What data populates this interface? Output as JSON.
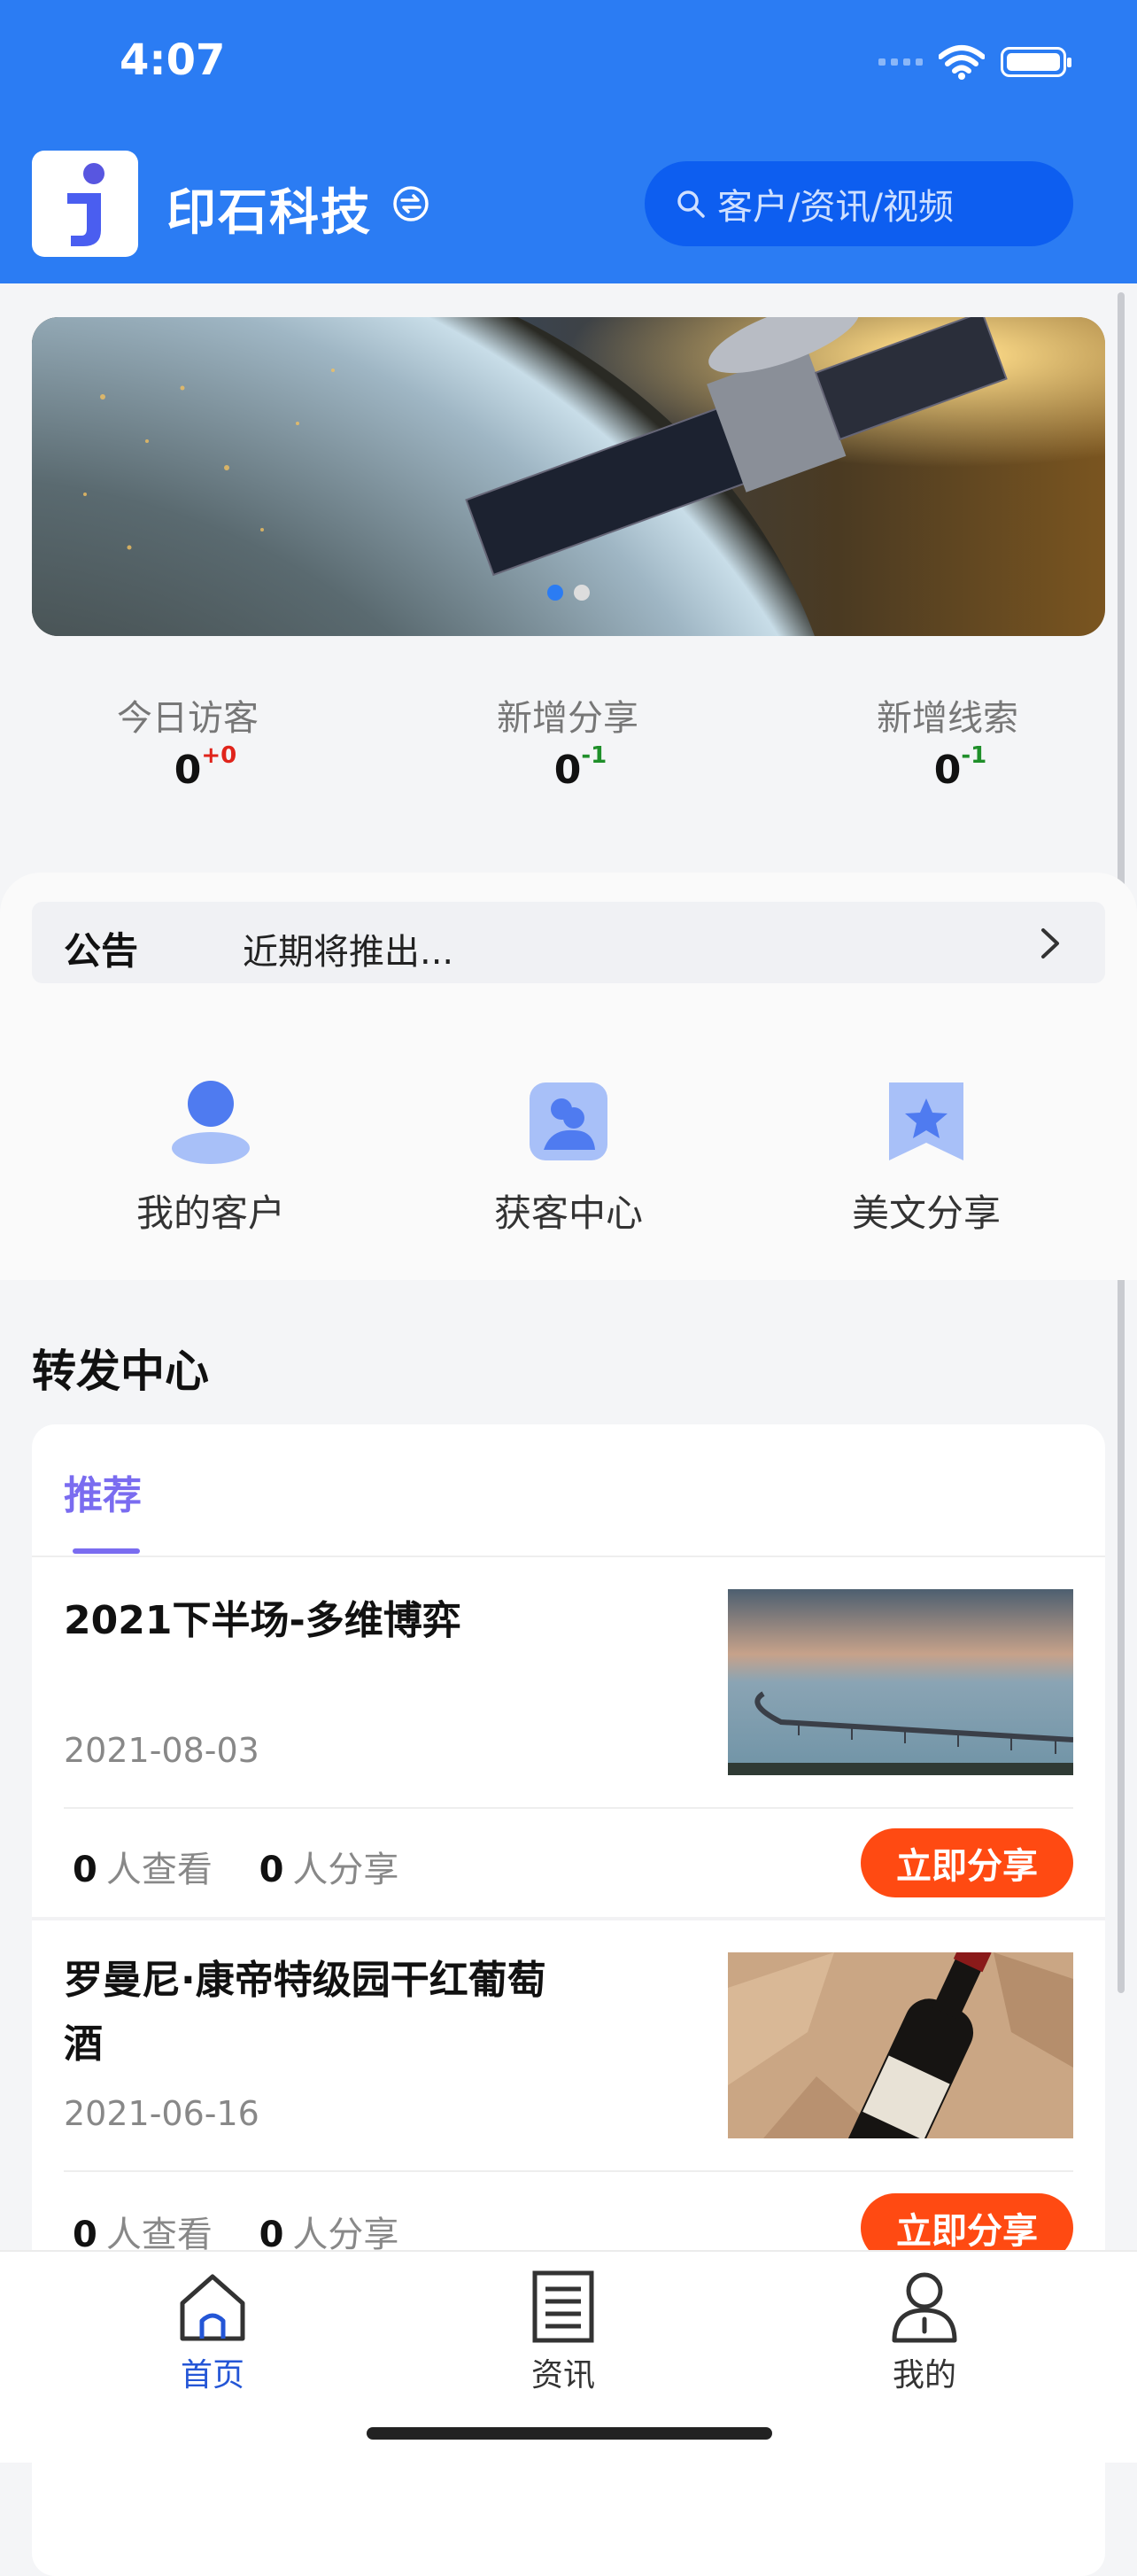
{
  "status": {
    "time": "4:07"
  },
  "header": {
    "app_name": "印石科技",
    "search_placeholder": "客户/资讯/视频"
  },
  "stats": [
    {
      "label": "今日访客",
      "value": "0",
      "delta": "+0",
      "delta_color": "#e0241b"
    },
    {
      "label": "新增分享",
      "value": "0",
      "delta": "-1",
      "delta_color": "#1f8f2a"
    },
    {
      "label": "新增线索",
      "value": "0",
      "delta": "-1",
      "delta_color": "#1f8f2a"
    }
  ],
  "notice": {
    "title": "公告",
    "text": "近期将推出..."
  },
  "quick_actions": [
    {
      "label": "我的客户",
      "icon": "person-icon"
    },
    {
      "label": "获客中心",
      "icon": "contacts-icon"
    },
    {
      "label": "美文分享",
      "icon": "star-bookmark-icon"
    }
  ],
  "section_title": "转发中心",
  "tabs": {
    "recommend": "推荐"
  },
  "articles": [
    {
      "title": "2021下半场-多维博弈",
      "date": "2021-08-03",
      "views": "0",
      "views_label": "人查看",
      "shares": "0",
      "shares_label": "人分享",
      "button": "立即分享"
    },
    {
      "title": "罗曼尼·康帝特级园干红葡萄酒",
      "date": "2021-06-16",
      "views": "0",
      "views_label": "人查看",
      "shares": "0",
      "shares_label": "人分享",
      "button": "立即分享"
    }
  ],
  "tabbar": [
    {
      "label": "首页",
      "icon": "home-icon",
      "active": true
    },
    {
      "label": "资讯",
      "icon": "document-icon",
      "active": false
    },
    {
      "label": "我的",
      "icon": "profile-icon",
      "active": false
    }
  ],
  "colors": {
    "primary": "#2b7cf3",
    "accent": "#ff4a12",
    "tab_active": "#7a6cf0"
  }
}
